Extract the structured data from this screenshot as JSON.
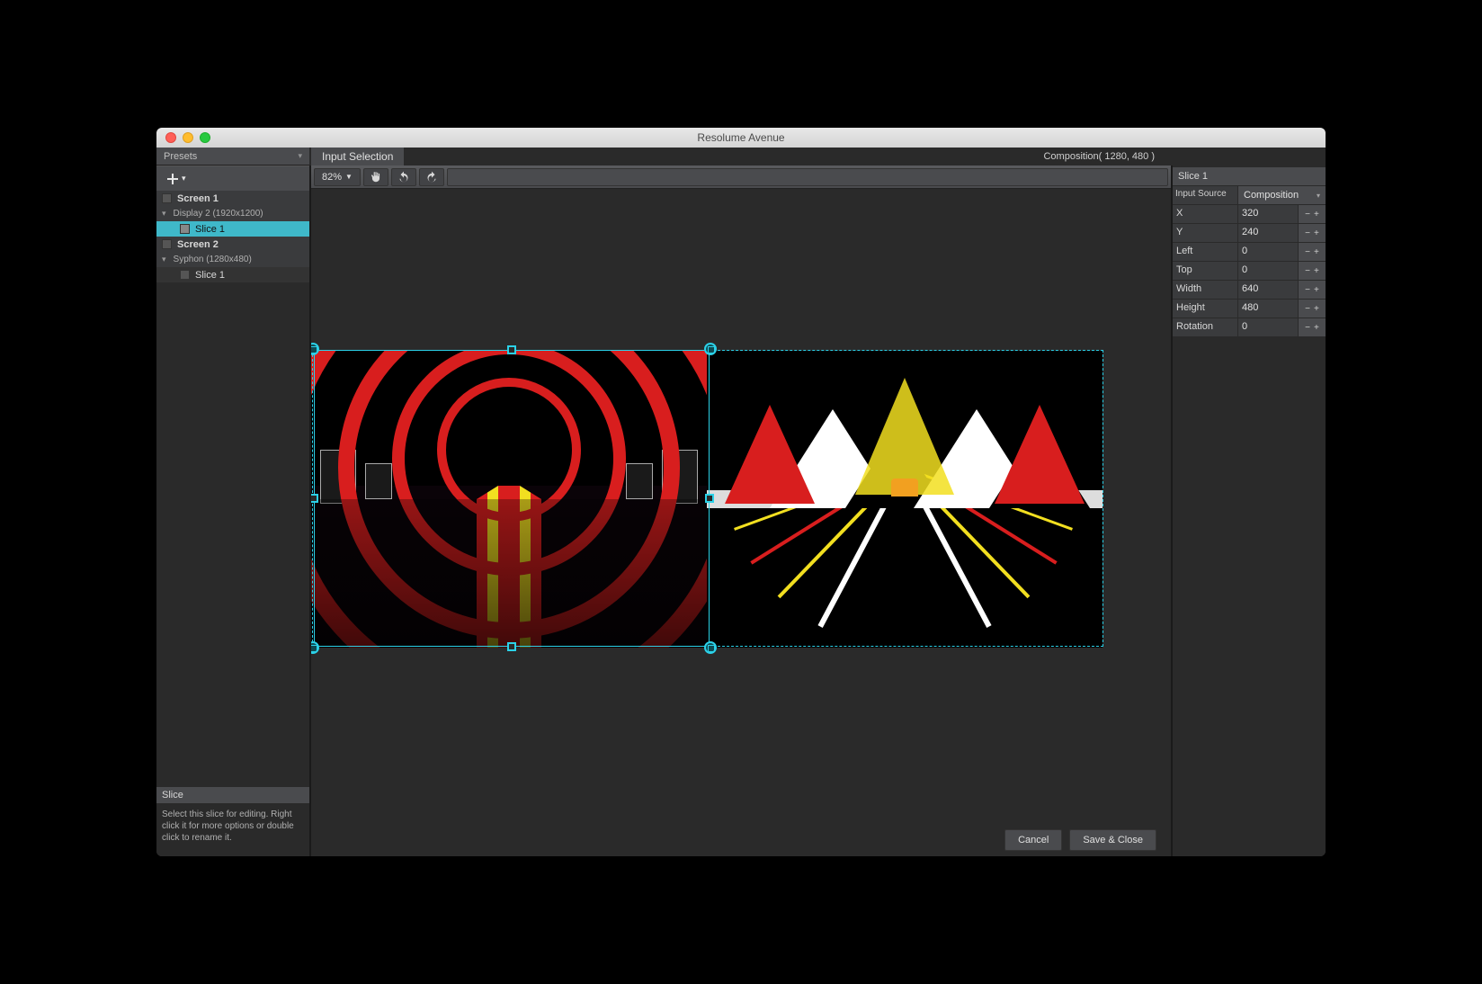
{
  "title": "Resolume Avenue",
  "sidebar": {
    "header": "Presets",
    "items": [
      {
        "type": "screen",
        "label": "Screen 1"
      },
      {
        "type": "display",
        "label": "Display 2 (1920x1200)"
      },
      {
        "type": "slice",
        "label": "Slice 1",
        "selected": true
      },
      {
        "type": "screen",
        "label": "Screen 2"
      },
      {
        "type": "display",
        "label": "Syphon (1280x480)"
      },
      {
        "type": "slice",
        "label": "Slice 1",
        "selected": false
      }
    ],
    "help_title": "Slice",
    "help_text": "Select this slice for editing. Right click it for more options or double click to rename it."
  },
  "header": {
    "tab": "Input Selection",
    "composition": "Composition( 1280, 480 )"
  },
  "toolbar": {
    "zoom": "82%"
  },
  "rpanel": {
    "title": "Slice 1",
    "source_label": "Input Source",
    "source_value": "Composition",
    "props": [
      {
        "label": "X",
        "value": "320"
      },
      {
        "label": "Y",
        "value": "240"
      },
      {
        "label": "Left",
        "value": "0"
      },
      {
        "label": "Top",
        "value": "0"
      },
      {
        "label": "Width",
        "value": "640"
      },
      {
        "label": "Height",
        "value": "480"
      },
      {
        "label": "Rotation",
        "value": "0"
      }
    ]
  },
  "footer": {
    "cancel": "Cancel",
    "save": "Save & Close"
  }
}
